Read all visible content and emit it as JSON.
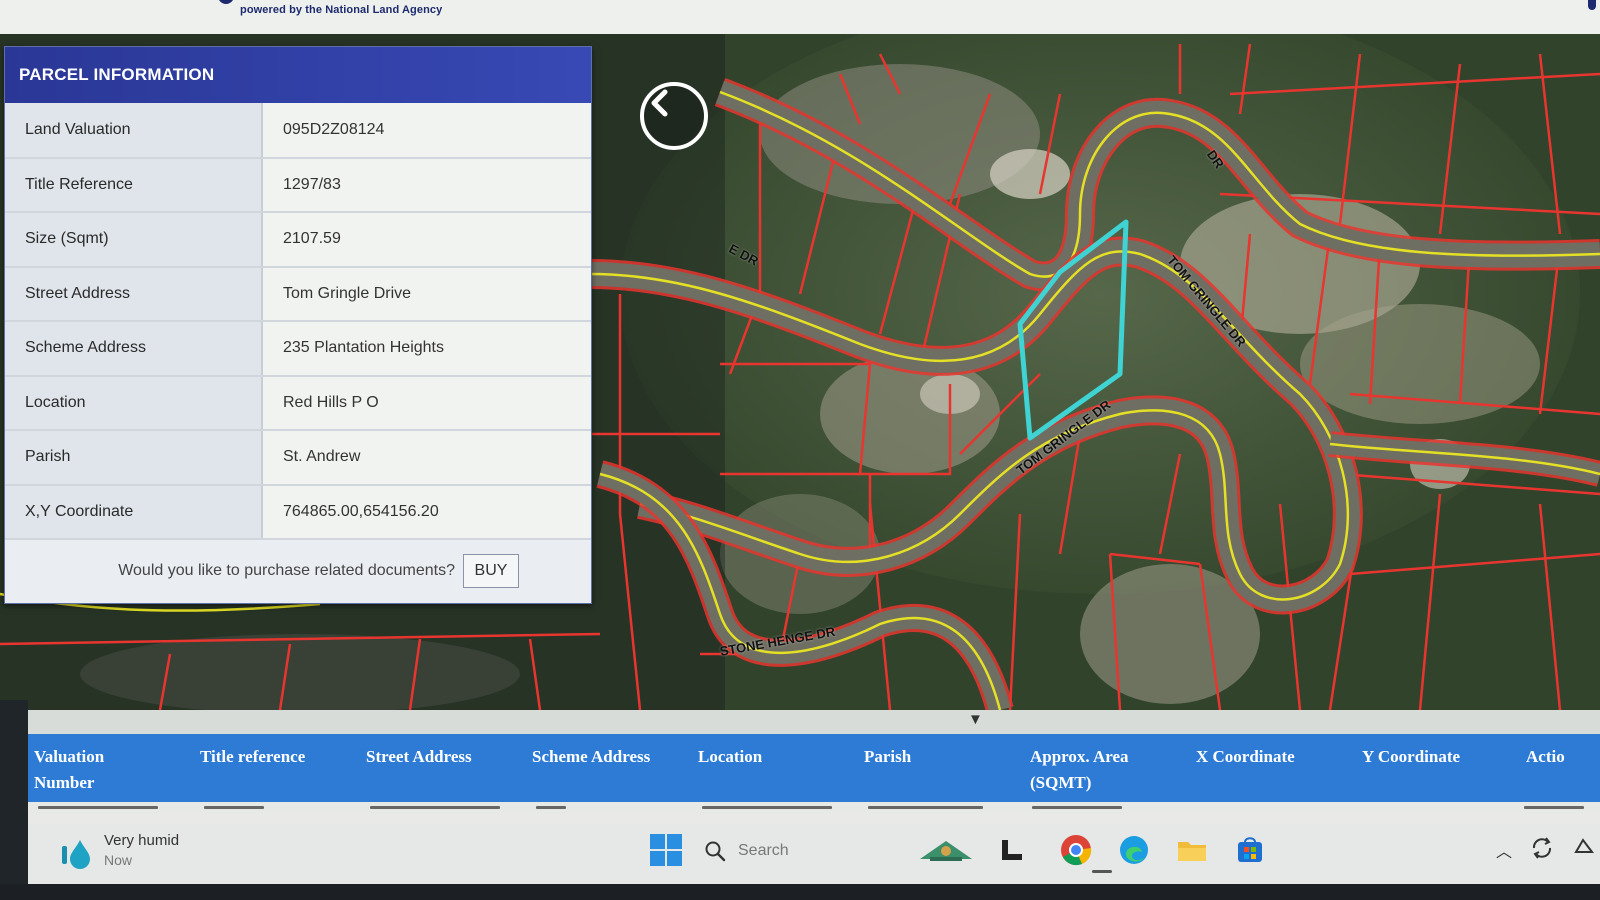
{
  "header": {
    "powered_by": "powered by the National Land Agency"
  },
  "panel": {
    "title": "PARCEL INFORMATION",
    "rows": [
      {
        "label": "Land Valuation",
        "value": "095D2Z08124"
      },
      {
        "label": "Title Reference",
        "value": "1297/83"
      },
      {
        "label": "Size (Sqmt)",
        "value": "2107.59"
      },
      {
        "label": "Street Address",
        "value": "Tom Gringle Drive"
      },
      {
        "label": "Scheme Address",
        "value": "235 Plantation Heights"
      },
      {
        "label": "Location",
        "value": "Red Hills P O"
      },
      {
        "label": "Parish",
        "value": "St. Andrew"
      },
      {
        "label": "X,Y Coordinate",
        "value": "764865.00,654156.20"
      }
    ],
    "purchase_prompt": "Would you like to purchase related documents?",
    "buy_label": "BUY"
  },
  "map": {
    "road_labels": [
      "TOM GRINGLE DR",
      "TOM GRINGLE DR",
      "STONE HENGE DR",
      "DR",
      "E DR"
    ],
    "colors": {
      "parcel_line": "#e8352f",
      "road_line": "#e4e025",
      "selected_parcel": "#3fd3d3"
    }
  },
  "results": {
    "collapse_icon": "triangle-down",
    "columns": [
      {
        "line1": "Valuation",
        "line2": "Number"
      },
      {
        "line1": "Title reference",
        "line2": ""
      },
      {
        "line1": "Street Address",
        "line2": ""
      },
      {
        "line1": "Scheme Address",
        "line2": ""
      },
      {
        "line1": "Location",
        "line2": ""
      },
      {
        "line1": "Parish",
        "line2": ""
      },
      {
        "line1": "Approx. Area",
        "line2": "(SQMT)"
      },
      {
        "line1": "X Coordinate",
        "line2": ""
      },
      {
        "line1": "Y Coordinate",
        "line2": ""
      },
      {
        "line1": "Actio",
        "line2": ""
      }
    ],
    "accent_color": "#2e7bd6"
  },
  "taskbar": {
    "weather_title": "Very humid",
    "weather_sub": "Now",
    "search_placeholder": "Search",
    "apps": [
      "copilot-icon",
      "file-manager-icon",
      "chrome-icon",
      "edge-icon",
      "folder-icon",
      "store-icon"
    ]
  }
}
